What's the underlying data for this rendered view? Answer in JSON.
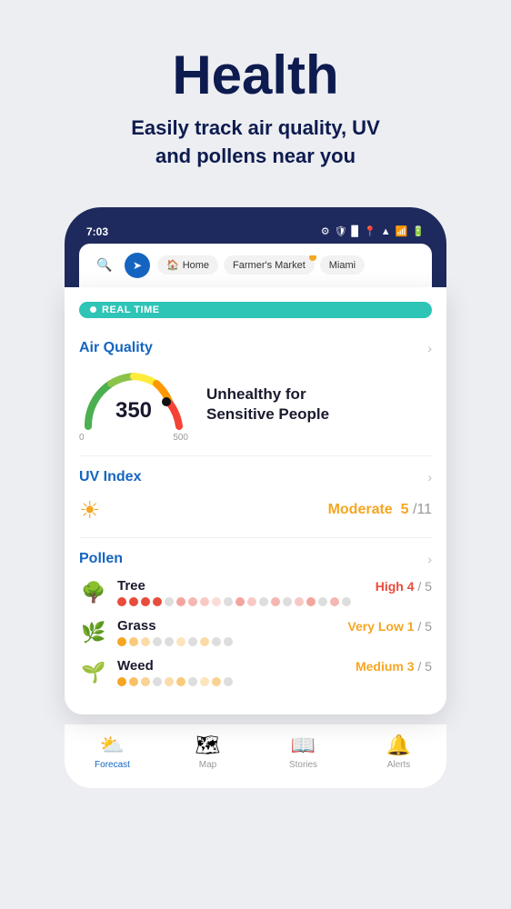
{
  "header": {
    "title": "Health",
    "subtitle": "Easily track air quality, UV\nand pollens near you"
  },
  "statusBar": {
    "time": "7:03",
    "icons": [
      "⚙",
      "🛡",
      "🔋",
      "📍",
      "▲",
      "📶",
      "🔋"
    ]
  },
  "navBar": {
    "tabs": [
      {
        "icon": "🏠",
        "label": "Home",
        "hasDot": false
      },
      {
        "icon": "",
        "label": "Farmer's Market",
        "hasDot": true
      },
      {
        "icon": "",
        "label": "Miami",
        "hasDot": false
      }
    ]
  },
  "realtimeBadge": "REAL TIME",
  "airQuality": {
    "title": "Air Quality",
    "value": "350",
    "minLabel": "0",
    "maxLabel": "500",
    "description": "Unhealthy for\nSensitive People"
  },
  "uvIndex": {
    "title": "UV Index",
    "level": "Moderate",
    "value": "5",
    "max": "11"
  },
  "pollen": {
    "title": "Pollen",
    "items": [
      {
        "name": "Tree",
        "level": "High",
        "levelClass": "level-high",
        "value": "4",
        "max": "5",
        "filledDots": 4,
        "emptyDots": 1,
        "dotColor": "dot-filled-red"
      },
      {
        "name": "Grass",
        "level": "Very Low",
        "levelClass": "level-verylow",
        "value": "1",
        "max": "5",
        "filledDots": 2,
        "emptyDots": 3,
        "dotColor": "dot-filled-orange"
      },
      {
        "name": "Weed",
        "level": "Medium",
        "levelClass": "level-medium",
        "value": "3",
        "max": "5",
        "filledDots": 3,
        "emptyDots": 2,
        "dotColor": "dot-filled-orange"
      }
    ]
  },
  "bottomNav": {
    "items": [
      {
        "icon": "⛅",
        "label": "Forecast",
        "active": true
      },
      {
        "icon": "🗺",
        "label": "Map",
        "active": false
      },
      {
        "icon": "📖",
        "label": "Stories",
        "active": false
      },
      {
        "icon": "🔔",
        "label": "Alerts",
        "active": false
      }
    ]
  }
}
